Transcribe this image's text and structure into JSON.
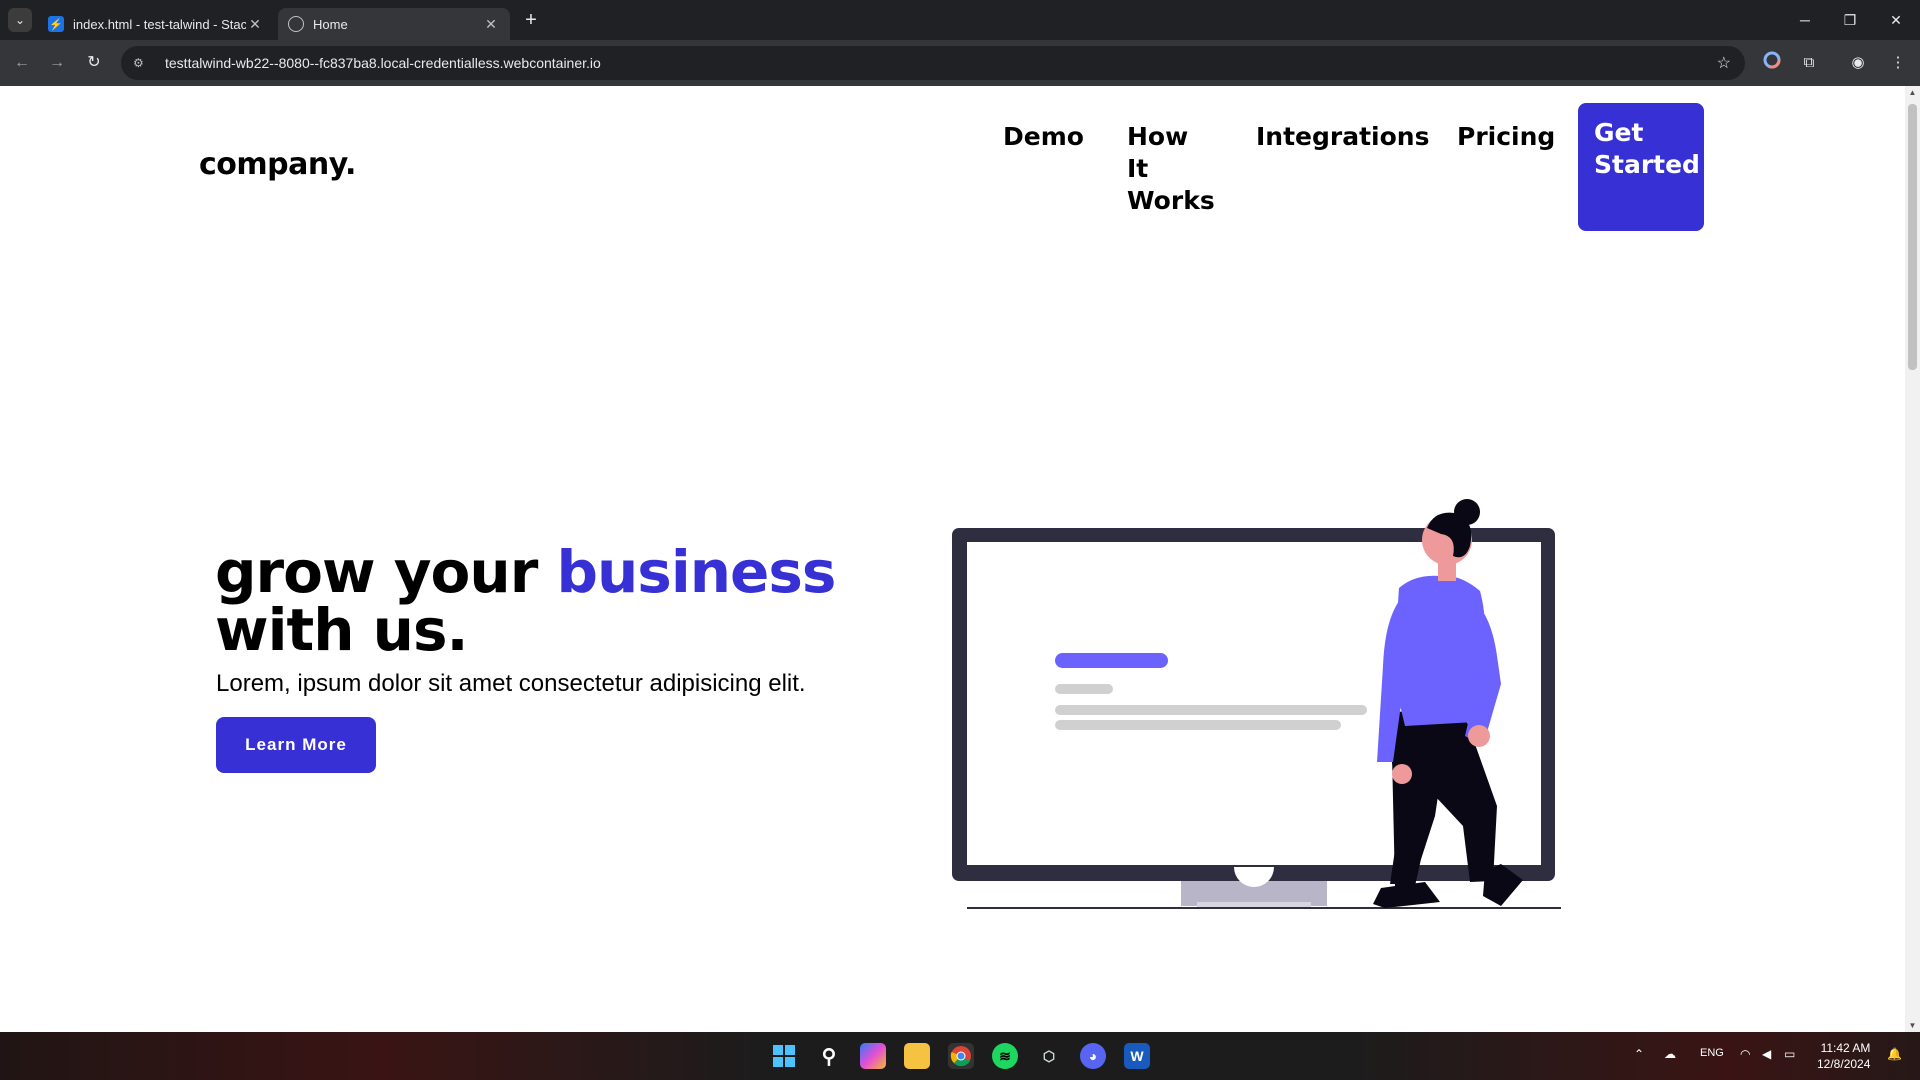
{
  "browser": {
    "tabs": [
      {
        "title": "index.html - test-talwind - Stack",
        "active": false
      },
      {
        "title": "Home",
        "active": true
      }
    ],
    "url": "testtalwind-wb22--8080--fc837ba8.local-credentialless.webcontainer.io"
  },
  "page": {
    "logo": "company.",
    "nav": {
      "demo": "Demo",
      "how": "How It Works",
      "integrations": "Integrations",
      "pricing": "Pricing",
      "cta": "Get Started"
    },
    "hero": {
      "title_part1": "grow your ",
      "title_accent": "business",
      "title_part2": "with us.",
      "subtitle": "Lorem, ipsum dolor sit amet consectetur adipisicing elit.",
      "button": "Learn More"
    },
    "colors": {
      "accent": "#3730d4",
      "illustration_accent": "#6c63ff"
    }
  },
  "taskbar": {
    "language": "ENG",
    "time": "11:42 AM",
    "date": "12/8/2024"
  }
}
